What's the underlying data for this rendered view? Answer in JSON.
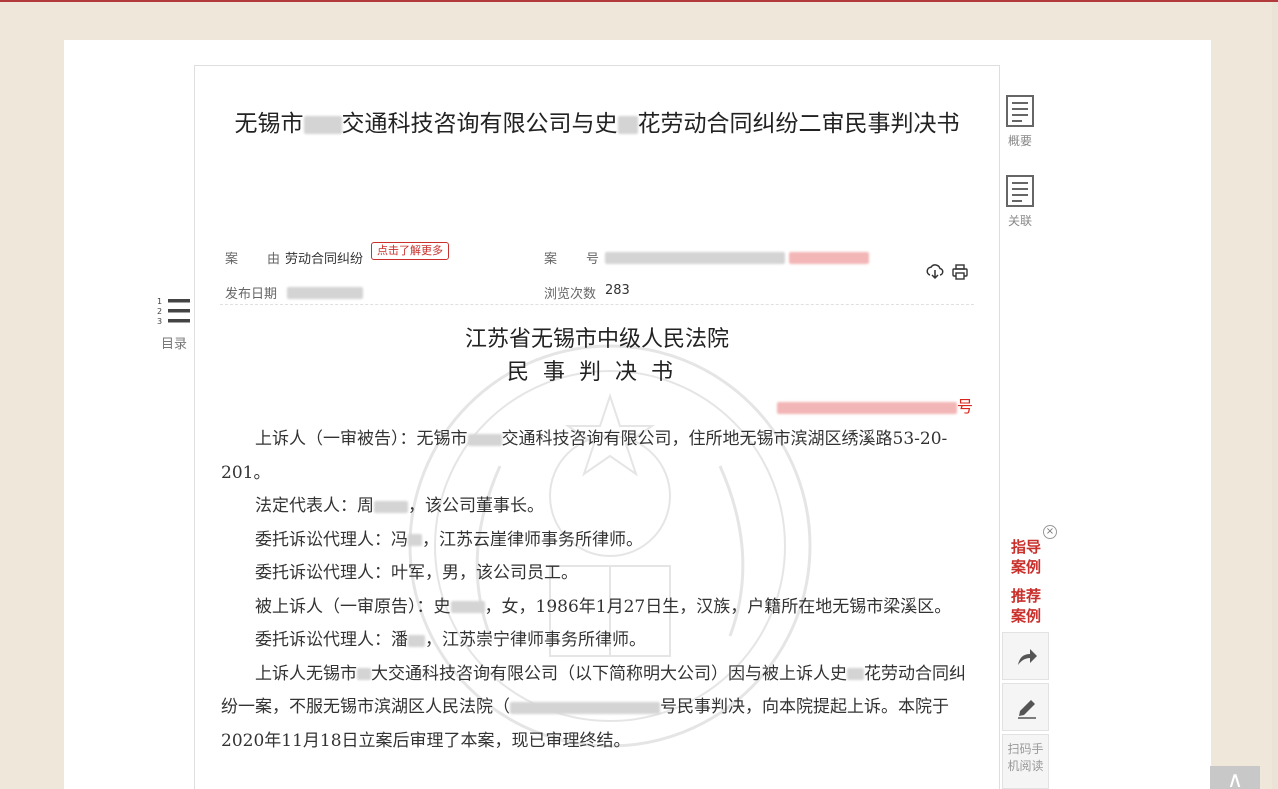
{
  "document": {
    "title": "无锡市明大交通科技咨询有限公司与史某花劳动合同纠纷二审民事判决书",
    "title_parts": [
      "无锡市",
      "交通科技咨询有限公司与史",
      "花劳动合同纠纷二审民事判决书"
    ],
    "meta": {
      "cause_label_1": "案",
      "cause_label_2": "由",
      "cause_value": "劳动合同纠纷",
      "learn_more": "点击了解更多",
      "caseno_label_1": "案",
      "caseno_label_2": "号",
      "publish_label": "发布日期",
      "views_label": "浏览次数",
      "views_value": "283"
    },
    "court": "江苏省无锡市中级人民法院",
    "doc_type": "民事判决书",
    "caseno_suffix": "号",
    "paragraphs": {
      "p1a": "上诉人（一审被告）：无锡市",
      "p1b": "交通科技咨询有限公司，住所地无锡市滨湖区绣溪路53-20-201。",
      "p2a": "法定代表人：周",
      "p2b": "，该公司董事长。",
      "p3a": "委托诉讼代理人：冯",
      "p3b": "，江苏云崖律师事务所律师。",
      "p4": "委托诉讼代理人：叶军，男，该公司员工。",
      "p5a": "被上诉人（一审原告）：史",
      "p5b": "，女，1986年1月27日生，汉族，户籍所在地无锡市梁溪区。",
      "p6a": "委托诉讼代理人：潘",
      "p6b": "，江苏崇宁律师事务所律师。",
      "p7a": "上诉人无锡市",
      "p7b": "大交通科技咨询有限公司（以下简称明大公司）因与被上诉人史",
      "p7c": "花劳动合同纠纷一案，不服无锡市滨湖区人民法院（",
      "p7d": "号民事判决，向本院提起上诉。本院于2020年11月18日立案后审理了本案，现已审理终结。"
    }
  },
  "side_nav": {
    "summary": "概要",
    "related": "关联",
    "toc": "目录",
    "toc_numbers": [
      "1",
      "2",
      "3"
    ]
  },
  "recommend": {
    "guide_1": "指导",
    "guide_2": "案例",
    "recommend_1": "推荐",
    "recommend_2": "案例",
    "close": "×"
  },
  "floating": {
    "qr_1": "扫码手",
    "qr_2": "机阅读",
    "to_top": "∧"
  },
  "colors": {
    "accent_red": "#c9302c",
    "background": "#efe8da"
  }
}
